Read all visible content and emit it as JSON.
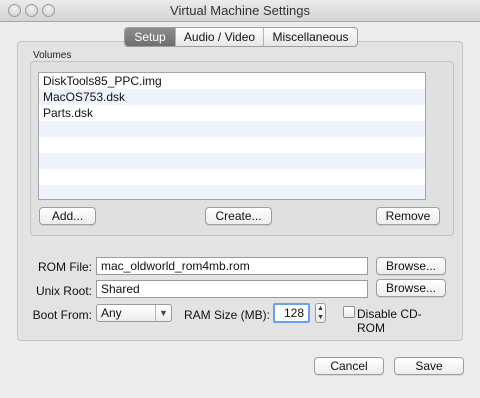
{
  "window": {
    "title": "Virtual Machine Settings"
  },
  "tabs": [
    {
      "label": "Setup",
      "active": true
    },
    {
      "label": "Audio / Video",
      "active": false
    },
    {
      "label": "Miscellaneous",
      "active": false
    }
  ],
  "volumes": {
    "group_label": "Volumes",
    "items": [
      "DiskTools85_PPC.img",
      "MacOS753.dsk",
      "Parts.dsk",
      "",
      "",
      "",
      "",
      ""
    ],
    "add_label": "Add...",
    "create_label": "Create...",
    "remove_label": "Remove"
  },
  "rom": {
    "label": "ROM File:",
    "value": "mac_oldworld_rom4mb.rom",
    "browse_label": "Browse..."
  },
  "unix_root": {
    "label": "Unix Root:",
    "value": "Shared",
    "browse_label": "Browse..."
  },
  "boot_from": {
    "label": "Boot From:",
    "value": "Any"
  },
  "ram": {
    "label": "RAM Size (MB):",
    "value": "128"
  },
  "disable_cdrom": {
    "label": "Disable CD-ROM",
    "checked": false
  },
  "footer": {
    "cancel_label": "Cancel",
    "save_label": "Save"
  }
}
